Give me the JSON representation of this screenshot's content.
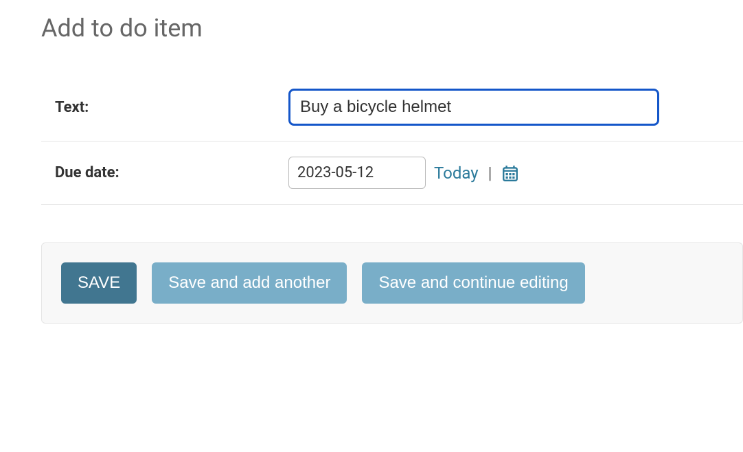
{
  "page": {
    "title": "Add to do item"
  },
  "form": {
    "text": {
      "label": "Text:",
      "value": "Buy a bicycle helmet"
    },
    "due_date": {
      "label": "Due date:",
      "value": "2023-05-12",
      "today_link": "Today",
      "separator": "|"
    }
  },
  "actions": {
    "save": "SAVE",
    "save_add_another": "Save and add another",
    "save_continue": "Save and continue editing"
  }
}
